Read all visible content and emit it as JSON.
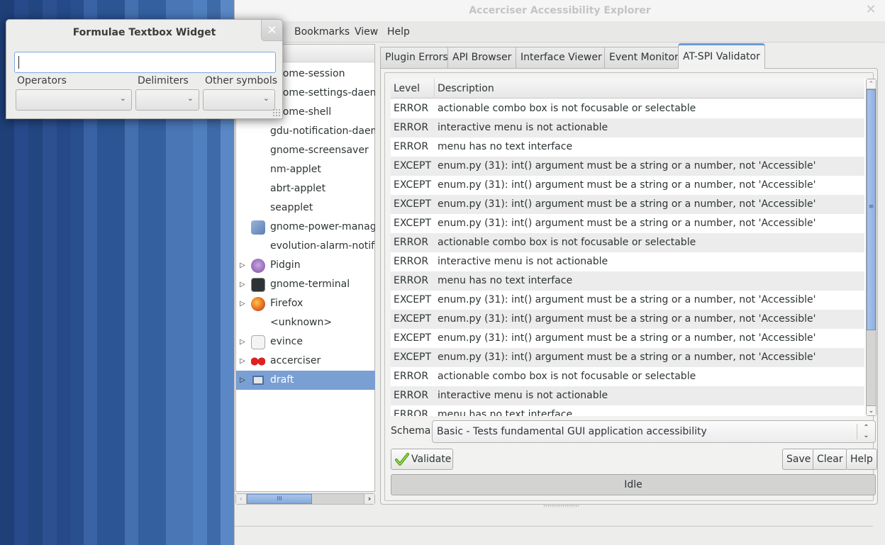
{
  "main_window": {
    "title": "Accerciser Accessibility Explorer",
    "close_icon": "close-icon",
    "menu": [
      "Bookmarks",
      "View",
      "Help"
    ]
  },
  "tree": {
    "items": [
      {
        "label": "gnome-session",
        "icon": "none",
        "expandable": false
      },
      {
        "label": "gnome-settings-daemon",
        "icon": "none",
        "expandable": false
      },
      {
        "label": "gnome-shell",
        "icon": "none",
        "expandable": false
      },
      {
        "label": "gdu-notification-daemon",
        "icon": "none",
        "expandable": false
      },
      {
        "label": "gnome-screensaver",
        "icon": "none",
        "expandable": false
      },
      {
        "label": "nm-applet",
        "icon": "none",
        "expandable": false
      },
      {
        "label": "abrt-applet",
        "icon": "none",
        "expandable": false
      },
      {
        "label": "seapplet",
        "icon": "none",
        "expandable": false
      },
      {
        "label": "gnome-power-manager",
        "icon": "power-manager-icon",
        "expandable": false
      },
      {
        "label": "evolution-alarm-notify",
        "icon": "none",
        "expandable": false
      },
      {
        "label": "Pidgin",
        "icon": "pidgin-icon",
        "expandable": true
      },
      {
        "label": "gnome-terminal",
        "icon": "terminal-icon",
        "expandable": true
      },
      {
        "label": "Firefox",
        "icon": "firefox-icon",
        "expandable": true
      },
      {
        "label": "<unknown>",
        "icon": "none",
        "expandable": false
      },
      {
        "label": "evince",
        "icon": "evince-icon",
        "expandable": true
      },
      {
        "label": "accerciser",
        "icon": "accerciser-icon",
        "expandable": true
      },
      {
        "label": "draft",
        "icon": "window-icon",
        "expandable": true,
        "selected": true
      }
    ]
  },
  "tabs": [
    {
      "label": "Plugin Errors",
      "active": false
    },
    {
      "label": "API Browser",
      "active": false
    },
    {
      "label": "Interface Viewer",
      "active": false
    },
    {
      "label": "Event Monitor",
      "active": false
    },
    {
      "label": "AT-SPI Validator",
      "active": true
    }
  ],
  "validator": {
    "columns": {
      "level": "Level",
      "description": "Description"
    },
    "rows": [
      {
        "level": "ERROR",
        "description": "actionable combo box is not focusable or selectable"
      },
      {
        "level": "ERROR",
        "description": "interactive menu is not actionable"
      },
      {
        "level": "ERROR",
        "description": "menu has no text interface"
      },
      {
        "level": "EXCEPT",
        "description": "enum.py (31): int() argument must be a string or a number, not 'Accessible'"
      },
      {
        "level": "EXCEPT",
        "description": "enum.py (31): int() argument must be a string or a number, not 'Accessible'"
      },
      {
        "level": "EXCEPT",
        "description": "enum.py (31): int() argument must be a string or a number, not 'Accessible'"
      },
      {
        "level": "EXCEPT",
        "description": "enum.py (31): int() argument must be a string or a number, not 'Accessible'"
      },
      {
        "level": "ERROR",
        "description": "actionable combo box is not focusable or selectable"
      },
      {
        "level": "ERROR",
        "description": "interactive menu is not actionable"
      },
      {
        "level": "ERROR",
        "description": "menu has no text interface"
      },
      {
        "level": "EXCEPT",
        "description": "enum.py (31): int() argument must be a string or a number, not 'Accessible'"
      },
      {
        "level": "EXCEPT",
        "description": "enum.py (31): int() argument must be a string or a number, not 'Accessible'"
      },
      {
        "level": "EXCEPT",
        "description": "enum.py (31): int() argument must be a string or a number, not 'Accessible'"
      },
      {
        "level": "EXCEPT",
        "description": "enum.py (31): int() argument must be a string or a number, not 'Accessible'"
      },
      {
        "level": "ERROR",
        "description": "actionable combo box is not focusable or selectable"
      },
      {
        "level": "ERROR",
        "description": "interactive menu is not actionable"
      },
      {
        "level": "ERROR",
        "description": "menu has no text interface"
      }
    ],
    "schema_label": "Schema:",
    "schema_value": "Basic - Tests fundamental GUI application accessibility",
    "validate_label": "Validate",
    "save_label": "Save",
    "clear_label": "Clear",
    "help_label": "Help",
    "status": "Idle"
  },
  "dialog": {
    "title": "Formulae Textbox Widget",
    "input_value": "",
    "labels": {
      "operators": "Operators",
      "delimiters": "Delimiters",
      "other": "Other symbols"
    },
    "operators_value": "",
    "delimiters_value": "",
    "other_value": ""
  },
  "icons": {
    "close": "✕",
    "chevron_down": "⌄",
    "expander": "▷",
    "up_down": "⌃⌄"
  },
  "colors": {
    "accent": "#7a9fd3",
    "tab_active_border": "#6d9bd6"
  }
}
